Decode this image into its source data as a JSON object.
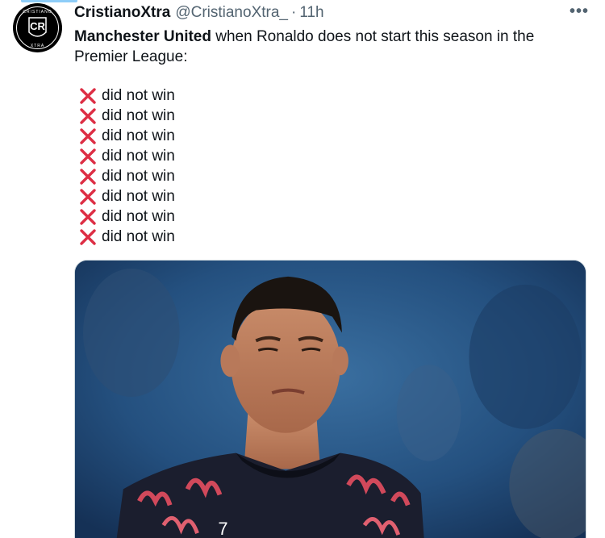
{
  "tweet": {
    "author_name": "CristianoXtra",
    "handle": "@CristianoXtra_",
    "separator": "·",
    "time": "11h",
    "more_label": "•••",
    "text_bold": "Manchester United",
    "text_rest": " when Ronaldo does not start this season in the Premier League:",
    "results": [
      "did not win",
      "did not win",
      "did not win",
      "did not win",
      "did not win",
      "did not win",
      "did not win",
      "did not win"
    ],
    "jersey_number": "7"
  },
  "avatar": {
    "top_text": "CRISTIANO",
    "center_text": "CR",
    "bottom_text": "XTRA"
  },
  "colors": {
    "x_mark": "#dd2e44",
    "text": "#0f1419",
    "muted": "#536471"
  },
  "icons": {
    "result_icon": "cross-mark-icon",
    "more_icon": "more-options-icon"
  }
}
